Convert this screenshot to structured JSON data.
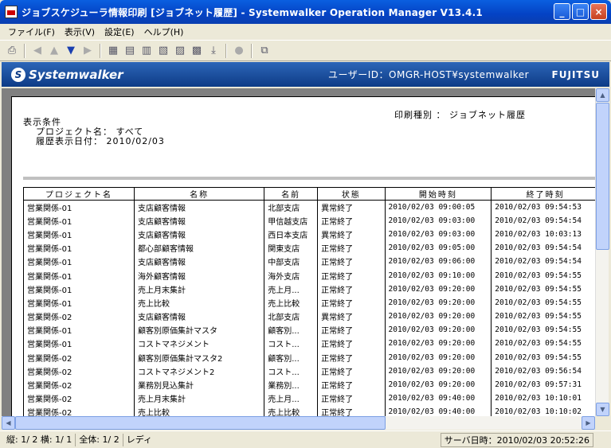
{
  "window": {
    "title": "ジョブスケジューラ情報印刷 [ジョブネット履歴] - Systemwalker Operation Manager  V13.4.1",
    "minimize": "_",
    "maximize": "□",
    "close": "×"
  },
  "menu": {
    "file": "ファイル(F)",
    "view": "表示(V)",
    "settings": "設定(E)",
    "help": "ヘルプ(H)"
  },
  "banner": {
    "logo": "Systemwalker",
    "user": "ユーザーID：OMGR-HOST¥systemwalker",
    "brand": "FUJITSU"
  },
  "report": {
    "print_type": "印刷種別 ： ジョブネット履歴",
    "cond_title": "表示条件",
    "project_label": "プロジェクト名： すべて",
    "date_label": "履歴表示日付：   2010/02/03"
  },
  "table": {
    "headers": [
      "プロジェクト名",
      "名称",
      "名前",
      "状態",
      "開始時刻",
      "終了時刻"
    ],
    "rows": [
      [
        "営業関係-01",
        "支店顧客情報",
        "北部支店",
        "異常終了",
        "2010/02/03 09:00:05",
        "2010/02/03 09:54:53"
      ],
      [
        "営業関係-01",
        "支店顧客情報",
        "甲信越支店",
        "正常終了",
        "2010/02/03 09:03:00",
        "2010/02/03 09:54:54"
      ],
      [
        "営業関係-01",
        "支店顧客情報",
        "西日本支店",
        "異常終了",
        "2010/02/03 09:03:00",
        "2010/02/03 10:03:13"
      ],
      [
        "営業関係-01",
        "都心部顧客情報",
        "関東支店",
        "正常終了",
        "2010/02/03 09:05:00",
        "2010/02/03 09:54:54"
      ],
      [
        "営業関係-01",
        "支店顧客情報",
        "中部支店",
        "正常終了",
        "2010/02/03 09:06:00",
        "2010/02/03 09:54:54"
      ],
      [
        "営業関係-01",
        "海外顧客情報",
        "海外支店",
        "正常終了",
        "2010/02/03 09:10:00",
        "2010/02/03 09:54:55"
      ],
      [
        "営業関係-01",
        "売上月末集計",
        "売上月...",
        "正常終了",
        "2010/02/03 09:20:00",
        "2010/02/03 09:54:55"
      ],
      [
        "営業関係-01",
        "売上比較",
        "売上比較",
        "正常終了",
        "2010/02/03 09:20:00",
        "2010/02/03 09:54:55"
      ],
      [
        "営業関係-02",
        "支店顧客情報",
        "北部支店",
        "異常終了",
        "2010/02/03 09:20:00",
        "2010/02/03 09:54:55"
      ],
      [
        "営業関係-01",
        "顧客別原価集計マスタ",
        "顧客別...",
        "正常終了",
        "2010/02/03 09:20:00",
        "2010/02/03 09:54:55"
      ],
      [
        "営業関係-01",
        "コストマネジメント",
        "コスト...",
        "正常終了",
        "2010/02/03 09:20:00",
        "2010/02/03 09:54:55"
      ],
      [
        "営業関係-02",
        "顧客別原価集計マスタ2",
        "顧客別...",
        "正常終了",
        "2010/02/03 09:20:00",
        "2010/02/03 09:54:55"
      ],
      [
        "営業関係-02",
        "コストマネジメント2",
        "コスト...",
        "正常終了",
        "2010/02/03 09:20:00",
        "2010/02/03 09:56:54"
      ],
      [
        "営業関係-02",
        "業務別見込集計",
        "業務別...",
        "正常終了",
        "2010/02/03 09:20:00",
        "2010/02/03 09:57:31"
      ],
      [
        "営業関係-02",
        "売上月末集計",
        "売上月...",
        "正常終了",
        "2010/02/03 09:40:00",
        "2010/02/03 10:10:01"
      ],
      [
        "営業関係-02",
        "売上比較",
        "売上比較",
        "正常終了",
        "2010/02/03 09:40:00",
        "2010/02/03 10:10:02"
      ]
    ]
  },
  "status": {
    "page": "縦: 1/ 2 横: 1/ 1",
    "total": "全体:  1/  2",
    "ready": "レディ",
    "server_time": "サーバ日時：2010/02/03 20:52:26"
  }
}
